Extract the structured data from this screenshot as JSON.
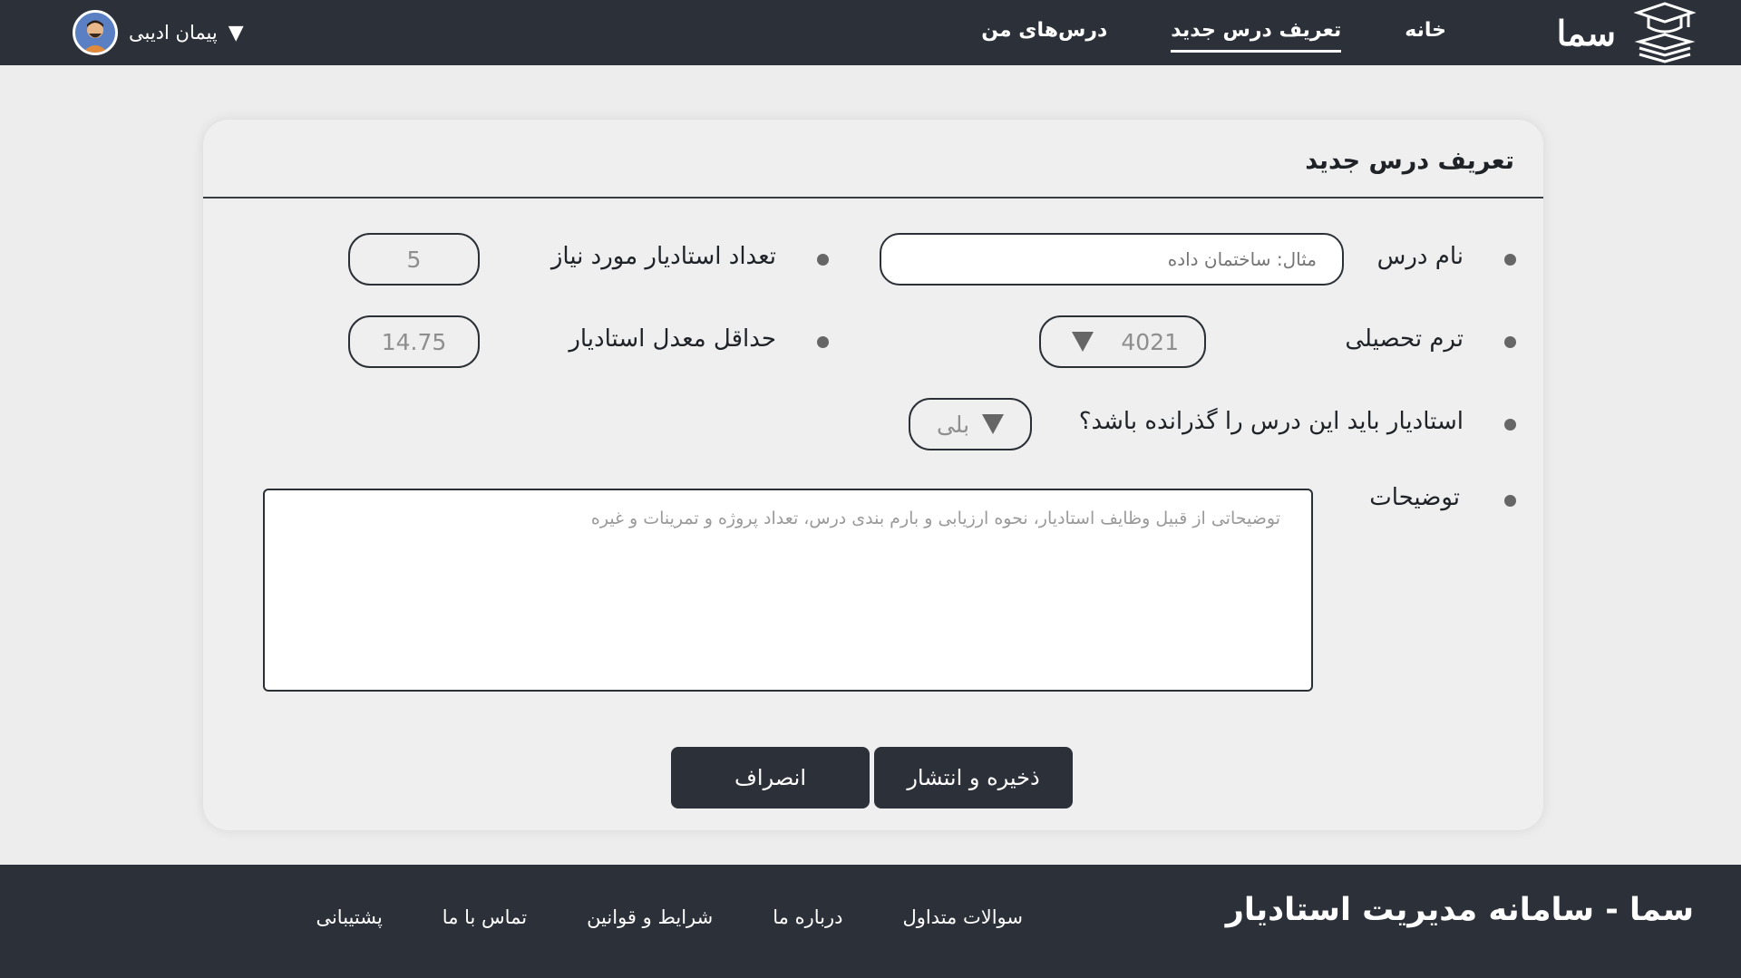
{
  "header": {
    "logo_text": "سما",
    "nav": [
      {
        "label": "خانه"
      },
      {
        "label": "تعریف درس جدید"
      },
      {
        "label": "درس‌های من"
      }
    ],
    "user_name": "پیمان ادیبی",
    "user_caret": "▼"
  },
  "form": {
    "title": "تعریف درس جدید",
    "course_name_label": "نام درس",
    "course_name_placeholder": "مثال: ساختمان داده",
    "ta_count_label": "تعداد استادیار مورد نیاز",
    "ta_count_value": "5",
    "term_label": "ترم تحصیلی",
    "term_value": "4021",
    "min_gpa_label": "حداقل معدل استادیار",
    "min_gpa_value": "14.75",
    "passed_label": "استادیار باید این درس را گذرانده باشد؟",
    "passed_value": "بلی",
    "description_label": "توضیحات",
    "description_placeholder": "توضیحاتی از قبیل وظایف استادیار، نحوه ارزیابی و بارم بندی درس، تعداد پروژه و تمرینات و غیره",
    "save_label": "ذخیره و انتشار",
    "cancel_label": "انصراف"
  },
  "footer": {
    "title": "سما - سامانه مدیریت استادیار",
    "links": [
      {
        "label": "سوالات متداول"
      },
      {
        "label": "درباره ما"
      },
      {
        "label": "شرایط و قوانین"
      },
      {
        "label": "تماس با ما"
      },
      {
        "label": "پشتیبانی"
      }
    ]
  },
  "icons": {
    "logo": "graduation-cap-books-icon",
    "avatar": "user-avatar",
    "dropdown": "triangle-down-icon"
  },
  "colors": {
    "header_bg": "#2c3039",
    "page_bg": "#ededed",
    "button_bg": "#2c3039"
  }
}
